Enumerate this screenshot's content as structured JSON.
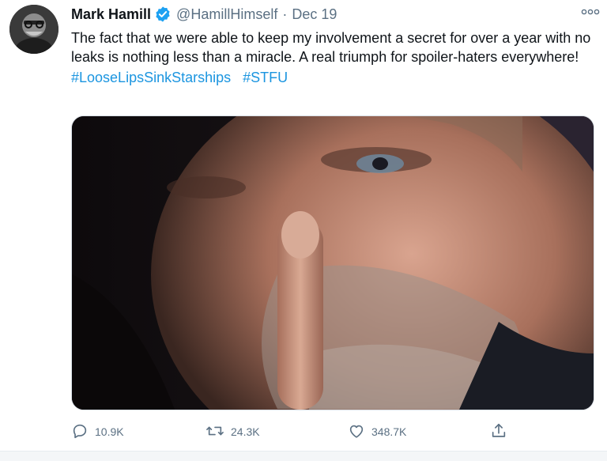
{
  "author": {
    "display_name": "Mark Hamill",
    "handle": "@HamillHimself",
    "separator": "·",
    "date": "Dec 19",
    "verified_icon": "verified-badge-icon",
    "verified_color": "#1da1f2"
  },
  "tweet": {
    "text": "The fact that we were able to keep my involvement a secret for over a year with no leaks is nothing less than a miracle. A real triumph for spoiler-haters everywhere!",
    "hashtags": [
      "#LooseLipsSinkStarships",
      "#STFU"
    ],
    "hashtag_color": "#1b95e0"
  },
  "media": {
    "icon": "photo-shushing-gesture"
  },
  "actions": {
    "reply": {
      "icon": "reply-icon",
      "count": "10.9K"
    },
    "retweet": {
      "icon": "retweet-icon",
      "count": "24.3K"
    },
    "like": {
      "icon": "heart-icon",
      "count": "348.7K"
    },
    "share": {
      "icon": "share-icon"
    }
  },
  "colors": {
    "text": "#0f1419",
    "secondary": "#5b7083"
  }
}
